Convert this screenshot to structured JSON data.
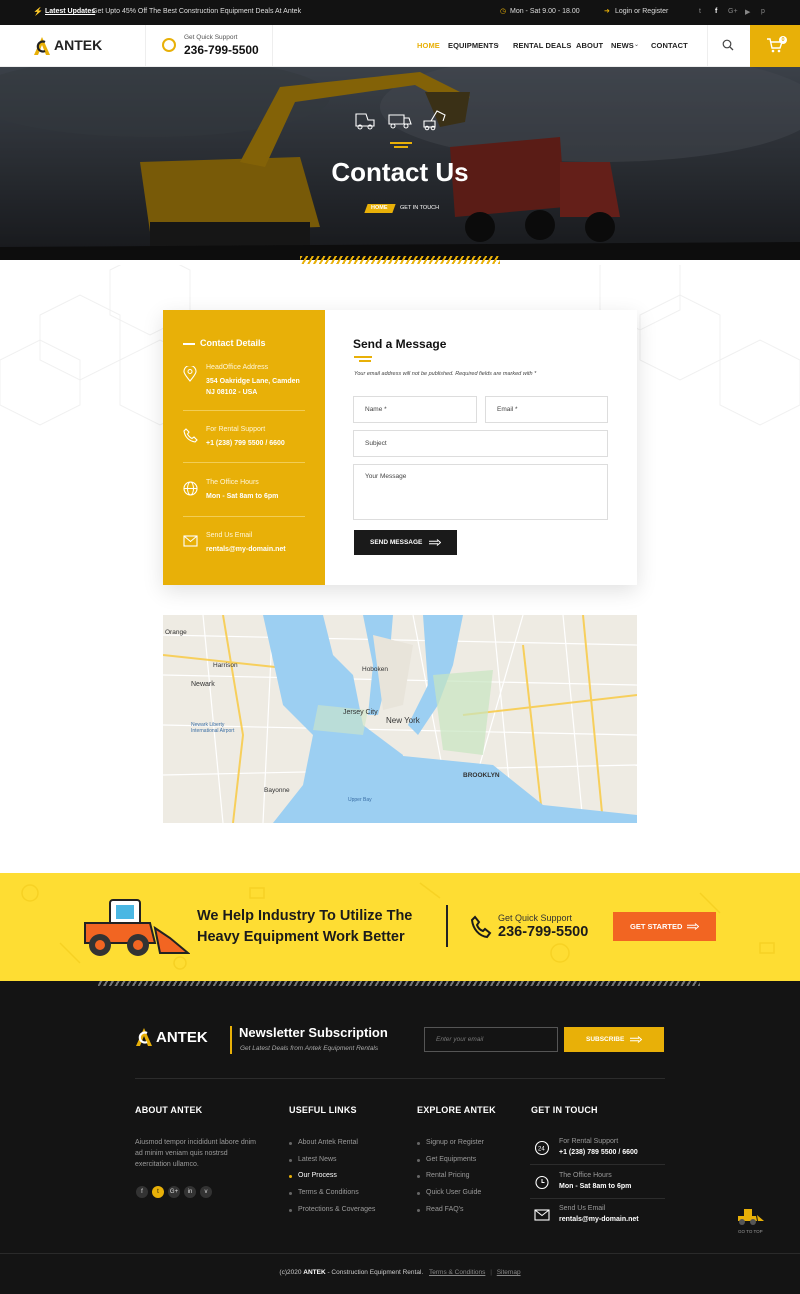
{
  "topbar": {
    "updates_label": "Latest Updates",
    "updates_text": "Get Upto 45% Off The Best Construction Equipment Deals At Antek",
    "hours": "Mon - Sat  9.00 - 18.00",
    "login": "Login or Register",
    "social_icons": [
      "twitter-icon",
      "facebook-icon",
      "google-plus-icon",
      "youtube-icon",
      "pinterest-icon"
    ]
  },
  "header": {
    "logo": "ANTEK",
    "support_label": "Get Quick Support",
    "support_phone": "236-799-5500",
    "nav": [
      "HOME",
      "EQUIPMENTS",
      "RENTAL DEALS",
      "ABOUT",
      "NEWS",
      "CONTACT"
    ],
    "active_nav": "HOME",
    "cart_count": "0"
  },
  "hero": {
    "title": "Contact Us",
    "breadcrumb_home": "HOME",
    "breadcrumb_current": "GET IN TOUCH"
  },
  "contact_details": {
    "heading": "Contact Details",
    "items": [
      {
        "icon": "location-pin-icon",
        "label": "HeadOffice Address",
        "value": "354  Oakridge Lane, Camden NJ 08102 - USA"
      },
      {
        "icon": "phone-icon",
        "label": "For Rental Support",
        "value": "+1 (238) 799 5500 / 6600"
      },
      {
        "icon": "globe-icon",
        "label": "The Office Hours",
        "value": "Mon - Sat 8am to 6pm"
      },
      {
        "icon": "mail-icon",
        "label": "Send Us Email",
        "value": "rentals@my-domain.net"
      }
    ]
  },
  "message_form": {
    "heading": "Send a Message",
    "note": "Your email address will not be published. Required fields are marked with *",
    "name_placeholder": "Name *",
    "email_placeholder": "Email *",
    "subject_placeholder": "Subject",
    "message_placeholder": "Your Message",
    "submit_label": "SEND MESSAGE"
  },
  "map": {
    "labels": [
      "Orange",
      "Harrison",
      "Newark",
      "Newark Liberty International Airport",
      "Bayonne",
      "Jersey City",
      "Hoboken",
      "New York",
      "BROOKLYN",
      "Upper Bay"
    ]
  },
  "cta": {
    "heading_line1": "We Help Industry To Utilize The",
    "heading_line2": "Heavy Equipment Work Better",
    "support_label": "Get Quick Support",
    "support_phone": "236-799-5500",
    "button": "GET STARTED"
  },
  "newsletter": {
    "logo": "ANTEK",
    "title": "Newsletter Subscription",
    "subtitle": "Get Latest Deals from Antek Equipment Rentals",
    "placeholder": "Enter your email",
    "button": "SUBSCRIBE"
  },
  "footer": {
    "about_heading": "ABOUT ANTEK",
    "about_text": "Aiusmod tempor incididunt labore dnim ad minim veniam quis nostrsd exercitation ullamco.",
    "social_icons": [
      "facebook-icon",
      "twitter-icon",
      "google-plus-icon",
      "linkedin-icon",
      "vimeo-icon"
    ],
    "social_glyphs": [
      "f",
      "t",
      "G+",
      "in",
      "v"
    ],
    "useful_heading": "USEFUL LINKS",
    "useful_links": [
      "About Antek Rental",
      "Latest News",
      "Our Process",
      "Terms & Conditions",
      "Protections & Coverages"
    ],
    "useful_active": "Our Process",
    "explore_heading": "EXPLORE ANTEK",
    "explore_links": [
      "Signup or Register",
      "Get Equipments",
      "Rental Pricing",
      "Quick User Guide",
      "Read FAQ's"
    ],
    "touch_heading": "GET IN TOUCH",
    "touch_items": [
      {
        "icon": "support-icon",
        "label": "For Rental Support",
        "value": "+1 (238) 789 5500 / 6600"
      },
      {
        "icon": "clock-icon",
        "label": "The Office Hours",
        "value": "Mon - Sat 8am to 6pm"
      },
      {
        "icon": "mail-icon",
        "label": "Send Us Email",
        "value": "rentals@my-domain.net"
      }
    ],
    "go_top": "GO TO TOP",
    "copyright_prefix": "(c)2020 ",
    "copyright_brand": "ANTEK",
    "copyright_suffix": " - Construction Equipment Rental.",
    "terms": "Terms & Conditions",
    "sitemap": "Sitemap"
  },
  "colors": {
    "accent": "#e8b008",
    "cta_bg": "#fedd33",
    "button_orange": "#f26522",
    "footer_bg": "#141414"
  }
}
